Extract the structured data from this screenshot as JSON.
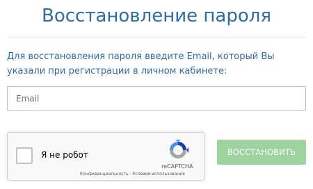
{
  "header": {
    "title": "Восстановление пароля"
  },
  "form": {
    "description": "Для восстановления пароля введите Email, который Вы указали при регистрации в личном кабинете:",
    "email_placeholder": "Email",
    "email_value": "",
    "submit_label": "ВОССТАНОВИТЬ",
    "submit_color": "#9ed29f"
  },
  "recaptcha": {
    "checkbox_label": "Я не робот",
    "brand": "reCAPTCHA",
    "privacy_link": "Конфиденциальность",
    "separator": " - ",
    "terms_link": "Условия использования",
    "icon": "recaptcha-logo-icon"
  },
  "colors": {
    "title": "#2f6c9f",
    "text": "#2f6c9f"
  }
}
